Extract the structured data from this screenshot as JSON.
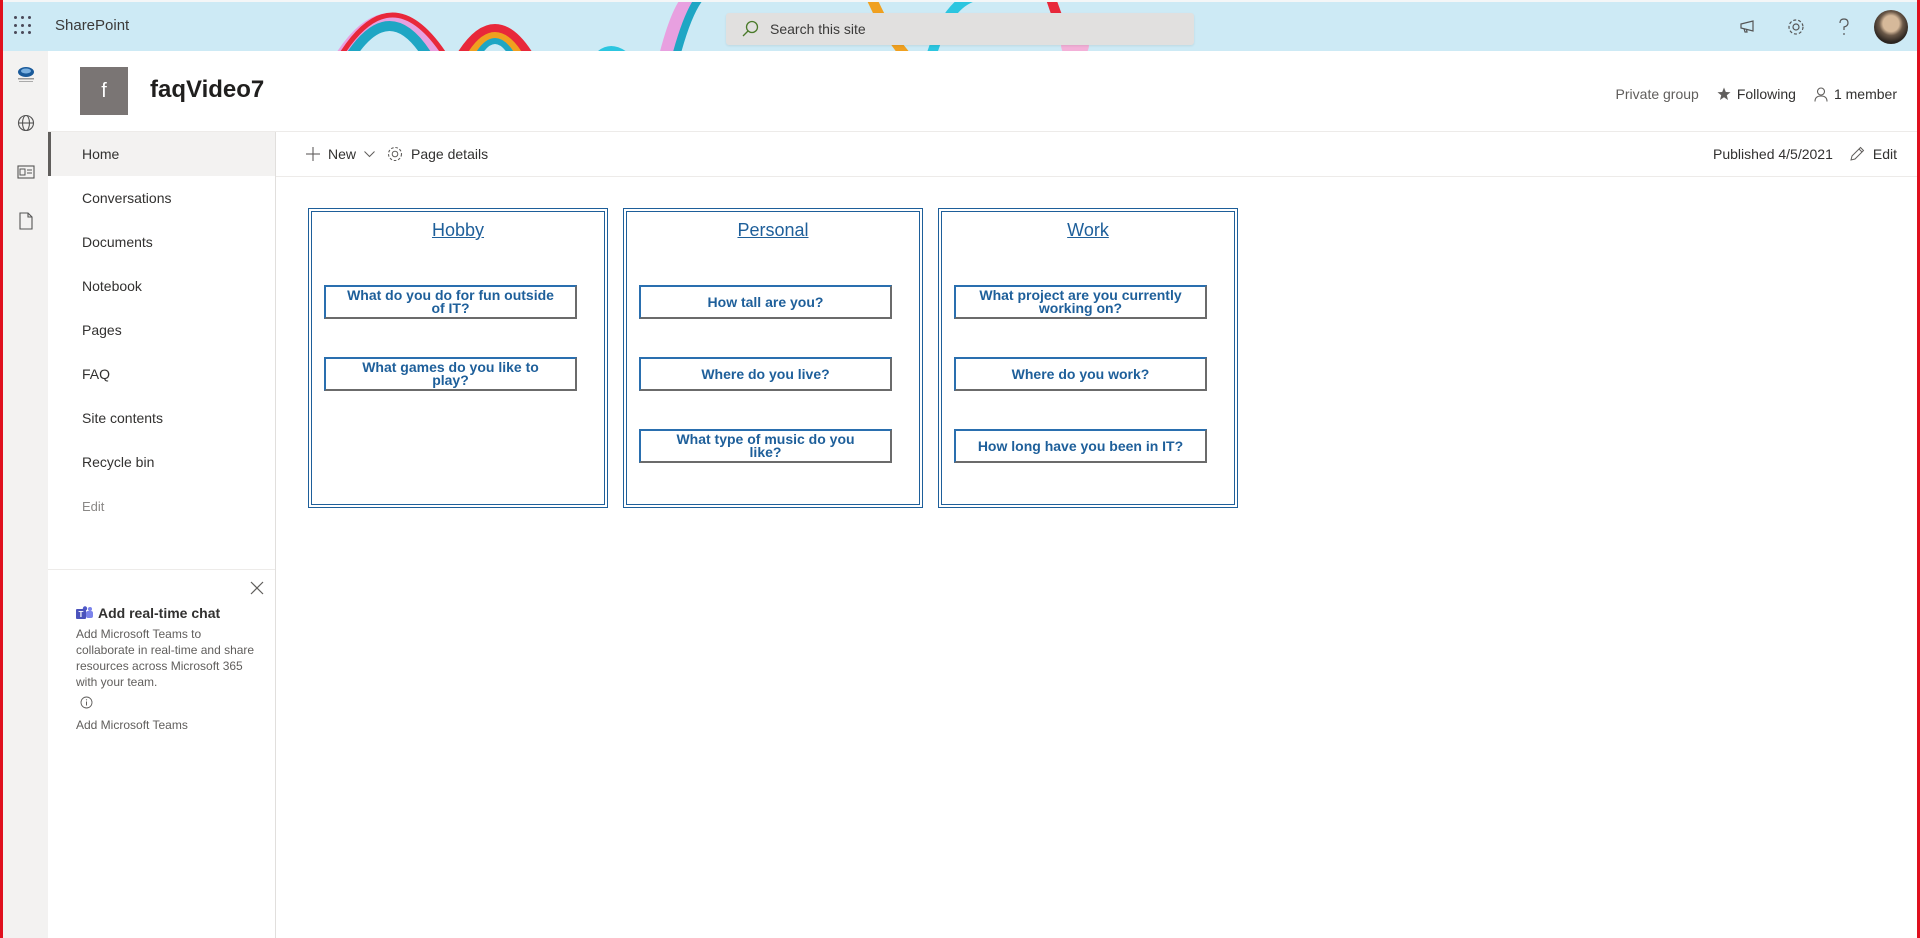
{
  "suite_bar": {
    "app_name": "SharePoint",
    "search_placeholder": "Search this site",
    "icons": [
      "waffle-icon",
      "megaphone-icon",
      "gear-icon",
      "help-icon",
      "avatar"
    ]
  },
  "app_bar": {
    "items": [
      {
        "name": "org-logo",
        "icon": "org-logo-icon"
      },
      {
        "name": "sites",
        "icon": "globe-icon"
      },
      {
        "name": "news",
        "icon": "news-icon"
      },
      {
        "name": "files",
        "icon": "document-icon"
      }
    ]
  },
  "site_header": {
    "logo_letter": "f",
    "title": "faqVideo7",
    "privacy": "Private group",
    "follow_label": "Following",
    "members_label": "1 member"
  },
  "nav": {
    "items": [
      {
        "label": "Home",
        "active": true
      },
      {
        "label": "Conversations"
      },
      {
        "label": "Documents"
      },
      {
        "label": "Notebook"
      },
      {
        "label": "Pages"
      },
      {
        "label": "FAQ"
      },
      {
        "label": "Site contents"
      },
      {
        "label": "Recycle bin"
      }
    ],
    "edit_label": "Edit"
  },
  "teams_promo": {
    "title": "Add real-time chat",
    "description": "Add Microsoft Teams to collaborate in real-time and share resources across Microsoft 365 with your team.",
    "link": "Add Microsoft Teams"
  },
  "command_bar": {
    "new_label": "New",
    "page_details_label": "Page details",
    "published": "Published 4/5/2021",
    "edit_label": "Edit"
  },
  "cards": [
    {
      "title": "Hobby",
      "questions": [
        "What do you do for fun outside of IT?",
        "What games do you like to play?"
      ]
    },
    {
      "title": "Personal",
      "questions": [
        "How tall are you?",
        "Where do you live?",
        "What type of music do you like?"
      ]
    },
    {
      "title": "Work",
      "questions": [
        "What project are you currently working on?",
        "Where do you work?",
        "How long have you been in IT?"
      ]
    }
  ],
  "colors": {
    "suite_bar_bg": "#cdeaf5",
    "card_accent": "#1e5f9a",
    "frame_red": "#e0101e"
  }
}
